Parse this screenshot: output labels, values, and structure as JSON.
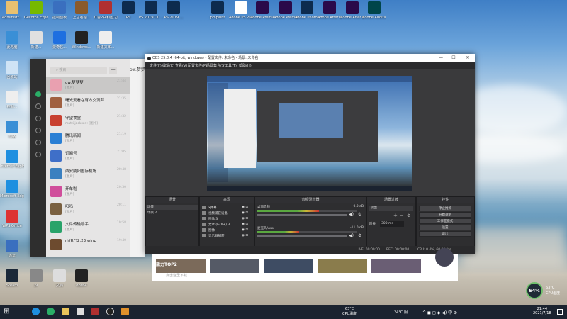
{
  "desktop_icons": [
    {
      "label": "Administr...",
      "color": "#e8c070"
    },
    {
      "label": "GeForce Experience",
      "color": "#76b900"
    },
    {
      "label": "控制面板",
      "color": "#3a6fbf"
    },
    {
      "label": "上古卷轴...",
      "color": "#8a5a2a"
    },
    {
      "label": "红警2共和国之辉",
      "color": "#b03030"
    },
    {
      "label": "PS",
      "color": "#0d2b4e"
    },
    {
      "label": "PS 2019 CC ...",
      "color": "#0d2b4e"
    },
    {
      "label": "PS 2019 ...",
      "color": "#0d2b4e"
    },
    {
      "label": "pmpaint",
      "color": "#0d2b4e"
    },
    {
      "label": "Adobe PS 2021...",
      "color": "#ffffff"
    },
    {
      "label": "Adobe Premiere...",
      "color": "#2a0a4a"
    },
    {
      "label": "Adobe Premiere...",
      "color": "#2a0a4a"
    },
    {
      "label": "Adobe Photoshop...",
      "color": "#0d2b4e"
    },
    {
      "label": "Adobe After Effects...",
      "color": "#2a0a4a"
    },
    {
      "label": "Adobe After Effects ...",
      "color": "#2a0a4a"
    },
    {
      "label": "Adobe Audition...",
      "color": "#00454a"
    },
    {
      "label": "此电脑",
      "color": "#3a8fd6"
    },
    {
      "label": "新建...",
      "color": "#e0e0e0"
    },
    {
      "label": "爱奇艺...",
      "color": "#1e6fe0"
    },
    {
      "label": "Windows...",
      "color": "#222"
    },
    {
      "label": "新建文本...",
      "color": "#eee"
    },
    {
      "label": "回收站",
      "color": "#cfe3f5"
    },
    {
      "label": "控制...",
      "color": "#eee"
    },
    {
      "label": "网络",
      "color": "#3a8fd6"
    },
    {
      "label": "Internet Explorer",
      "color": "#1e8fe0"
    },
    {
      "label": "Microsoft Edge",
      "color": "#1e8fe0"
    },
    {
      "label": "WPS Office",
      "color": "#d33"
    },
    {
      "label": "迅雷",
      "color": "#3a6fbf"
    },
    {
      "label": "Steam",
      "color": "#1b2838"
    },
    {
      "label": "jv",
      "color": "#888"
    },
    {
      "label": "文档",
      "color": "#ddd"
    },
    {
      "label": "obs64",
      "color": "#222"
    }
  ],
  "wechat": {
    "search_placeholder": "搜索",
    "plus": "+",
    "chat_title": "ow.梦梦梦",
    "chats": [
      {
        "name": "ow.梦梦梦",
        "preview": "[图片]",
        "time": "21:44",
        "color": "#e9a0b0"
      },
      {
        "name": "曙光爱看在有方交流群",
        "preview": "[图片]",
        "time": "21:35",
        "color": "#a06040"
      },
      {
        "name": "守望食堂",
        "preview": "matti.jackson: [图片]",
        "time": "21:32",
        "color": "#c84030"
      },
      {
        "name": "腾讯新闻",
        "preview": "[图片]",
        "time": "21:19",
        "color": "#2a7fd4"
      },
      {
        "name": "订阅号",
        "preview": "[图片]",
        "time": "21:05",
        "color": "#3f6fc8"
      },
      {
        "name": "西安咸阳国际机场...",
        "preview": "[图片]",
        "time": "20:48",
        "color": "#3a80c0"
      },
      {
        "name": "开车啦",
        "preview": "[图片]",
        "time": "20:30",
        "color": "#d04e9b"
      },
      {
        "name": "吗吗",
        "preview": "[图片]",
        "time": "20:11",
        "color": "#7a6040"
      },
      {
        "name": "文件传输助手",
        "preview": "[图片]",
        "time": "19:58",
        "color": "#29a36a"
      },
      {
        "name": "rh(RF)2.23 winp",
        "preview": "",
        "time": "19:40",
        "color": "#6d4b2f"
      }
    ]
  },
  "obs": {
    "title": "OBS 25.0.4 (64-bit, windows) - 配置文件: 未命名 - 场景: 未命名",
    "menu": [
      "文件(F)",
      "编辑(E)",
      "查看(V)",
      "配置文件(P)",
      "场景集合(S)",
      "工具(T)",
      "帮助(H)"
    ],
    "panels": {
      "scenes": {
        "title": "场景",
        "items": [
          "场景",
          "场景 2"
        ]
      },
      "sources": {
        "title": "来源",
        "items": [
          "x弹幕",
          "视频捕获设备",
          "图像 3",
          "文本 (GDI+) 3",
          "图像",
          "显示器捕获"
        ]
      },
      "mixer": {
        "title": "音频混音器",
        "channels": [
          {
            "name": "桌面音频",
            "db": "-0.0 dB",
            "level": 0.62
          },
          {
            "name": "麦克风/Aux",
            "db": "-11.0 dB",
            "level": 0.42
          }
        ]
      },
      "transitions": {
        "title": "场景过渡",
        "type": "淡出",
        "duration_label": "时长",
        "duration": "300 ms"
      },
      "controls": {
        "title": "控件",
        "buttons": [
          "停止推流",
          "开始录制",
          "工作室模式",
          "设置",
          "退出"
        ]
      }
    },
    "status": {
      "live": "LIVE: 00:00:00",
      "rec": "REC: 00:00:00",
      "cpu": "CPU: 0.4%, 60.00 fps"
    }
  },
  "browser": {
    "text": "能力TOP2",
    "subtext": "点击这里下载"
  },
  "cpu_widget": {
    "percent": "54%",
    "temp": "63°C",
    "label": "CPU温度"
  },
  "taskbar": {
    "weather": "24°C 阴",
    "cpu_tray": "63°C",
    "cpu_tray_label": "CPU温度",
    "time": "21:44",
    "date": "2021/7/18"
  }
}
